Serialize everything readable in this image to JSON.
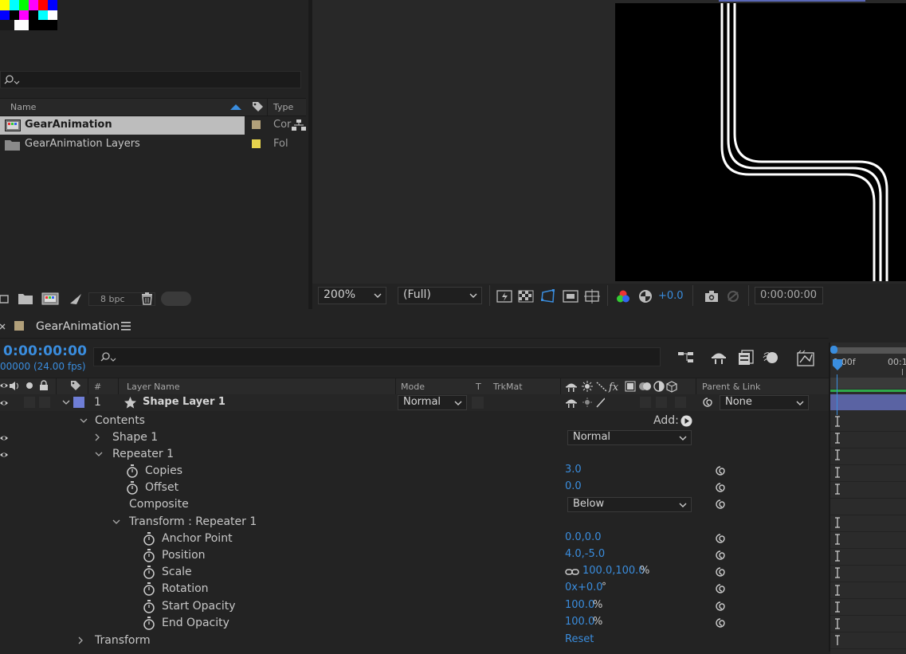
{
  "project": {
    "bpc": "8 bpc",
    "columns": {
      "name": "Name",
      "type": "Type"
    },
    "items": [
      {
        "name": "GearAnimation",
        "type": "Cor",
        "label_color": "#b2a07a"
      },
      {
        "name": "GearAnimation Layers",
        "type": "Fol",
        "label_color": "#e8d44d"
      }
    ]
  },
  "viewer": {
    "zoom": "200%",
    "resolution": "(Full)",
    "exposure": "+0.0",
    "timecode": "0:00:00:00"
  },
  "timeline": {
    "tab_title": "GearAnimation",
    "current_time": "0:00:00:00",
    "frame_rate": "00000 (24.00 fps)",
    "ruler": {
      "start": "0:00f",
      "next": "00:1"
    },
    "headers": {
      "num": "#",
      "layer_name": "Layer Name",
      "mode": "Mode",
      "t": "T",
      "trkmat": "TrkMat",
      "parent": "Parent & Link"
    },
    "layer": {
      "number": "1",
      "name": "Shape Layer 1",
      "mode": "Normal",
      "parent": "None",
      "label_color": "#6f7ed6"
    },
    "add_label": "Add:",
    "rows": {
      "contents": "Contents",
      "shape1": "Shape 1",
      "shape1_mode": "Normal",
      "repeater": "Repeater 1",
      "copies": "Copies",
      "copies_val": "3.0",
      "offset": "Offset",
      "offset_val": "0.0",
      "composite": "Composite",
      "composite_val": "Below",
      "transform_repeater": "Transform : Repeater 1",
      "anchor": "Anchor Point",
      "anchor_val": "0.0,0.0",
      "position": "Position",
      "position_val": "4.0,-5.0",
      "scale": "Scale",
      "scale_val": "100.0,100.0",
      "scale_unit": "%",
      "rotation": "Rotation",
      "rotation_val": "0x+0.0",
      "rotation_unit": "°",
      "start_opacity": "Start Opacity",
      "start_opacity_val": "100.0",
      "start_opacity_unit": "%",
      "end_opacity": "End Opacity",
      "end_opacity_val": "100.0",
      "end_opacity_unit": "%",
      "transform": "Transform",
      "transform_val": "Reset"
    }
  }
}
